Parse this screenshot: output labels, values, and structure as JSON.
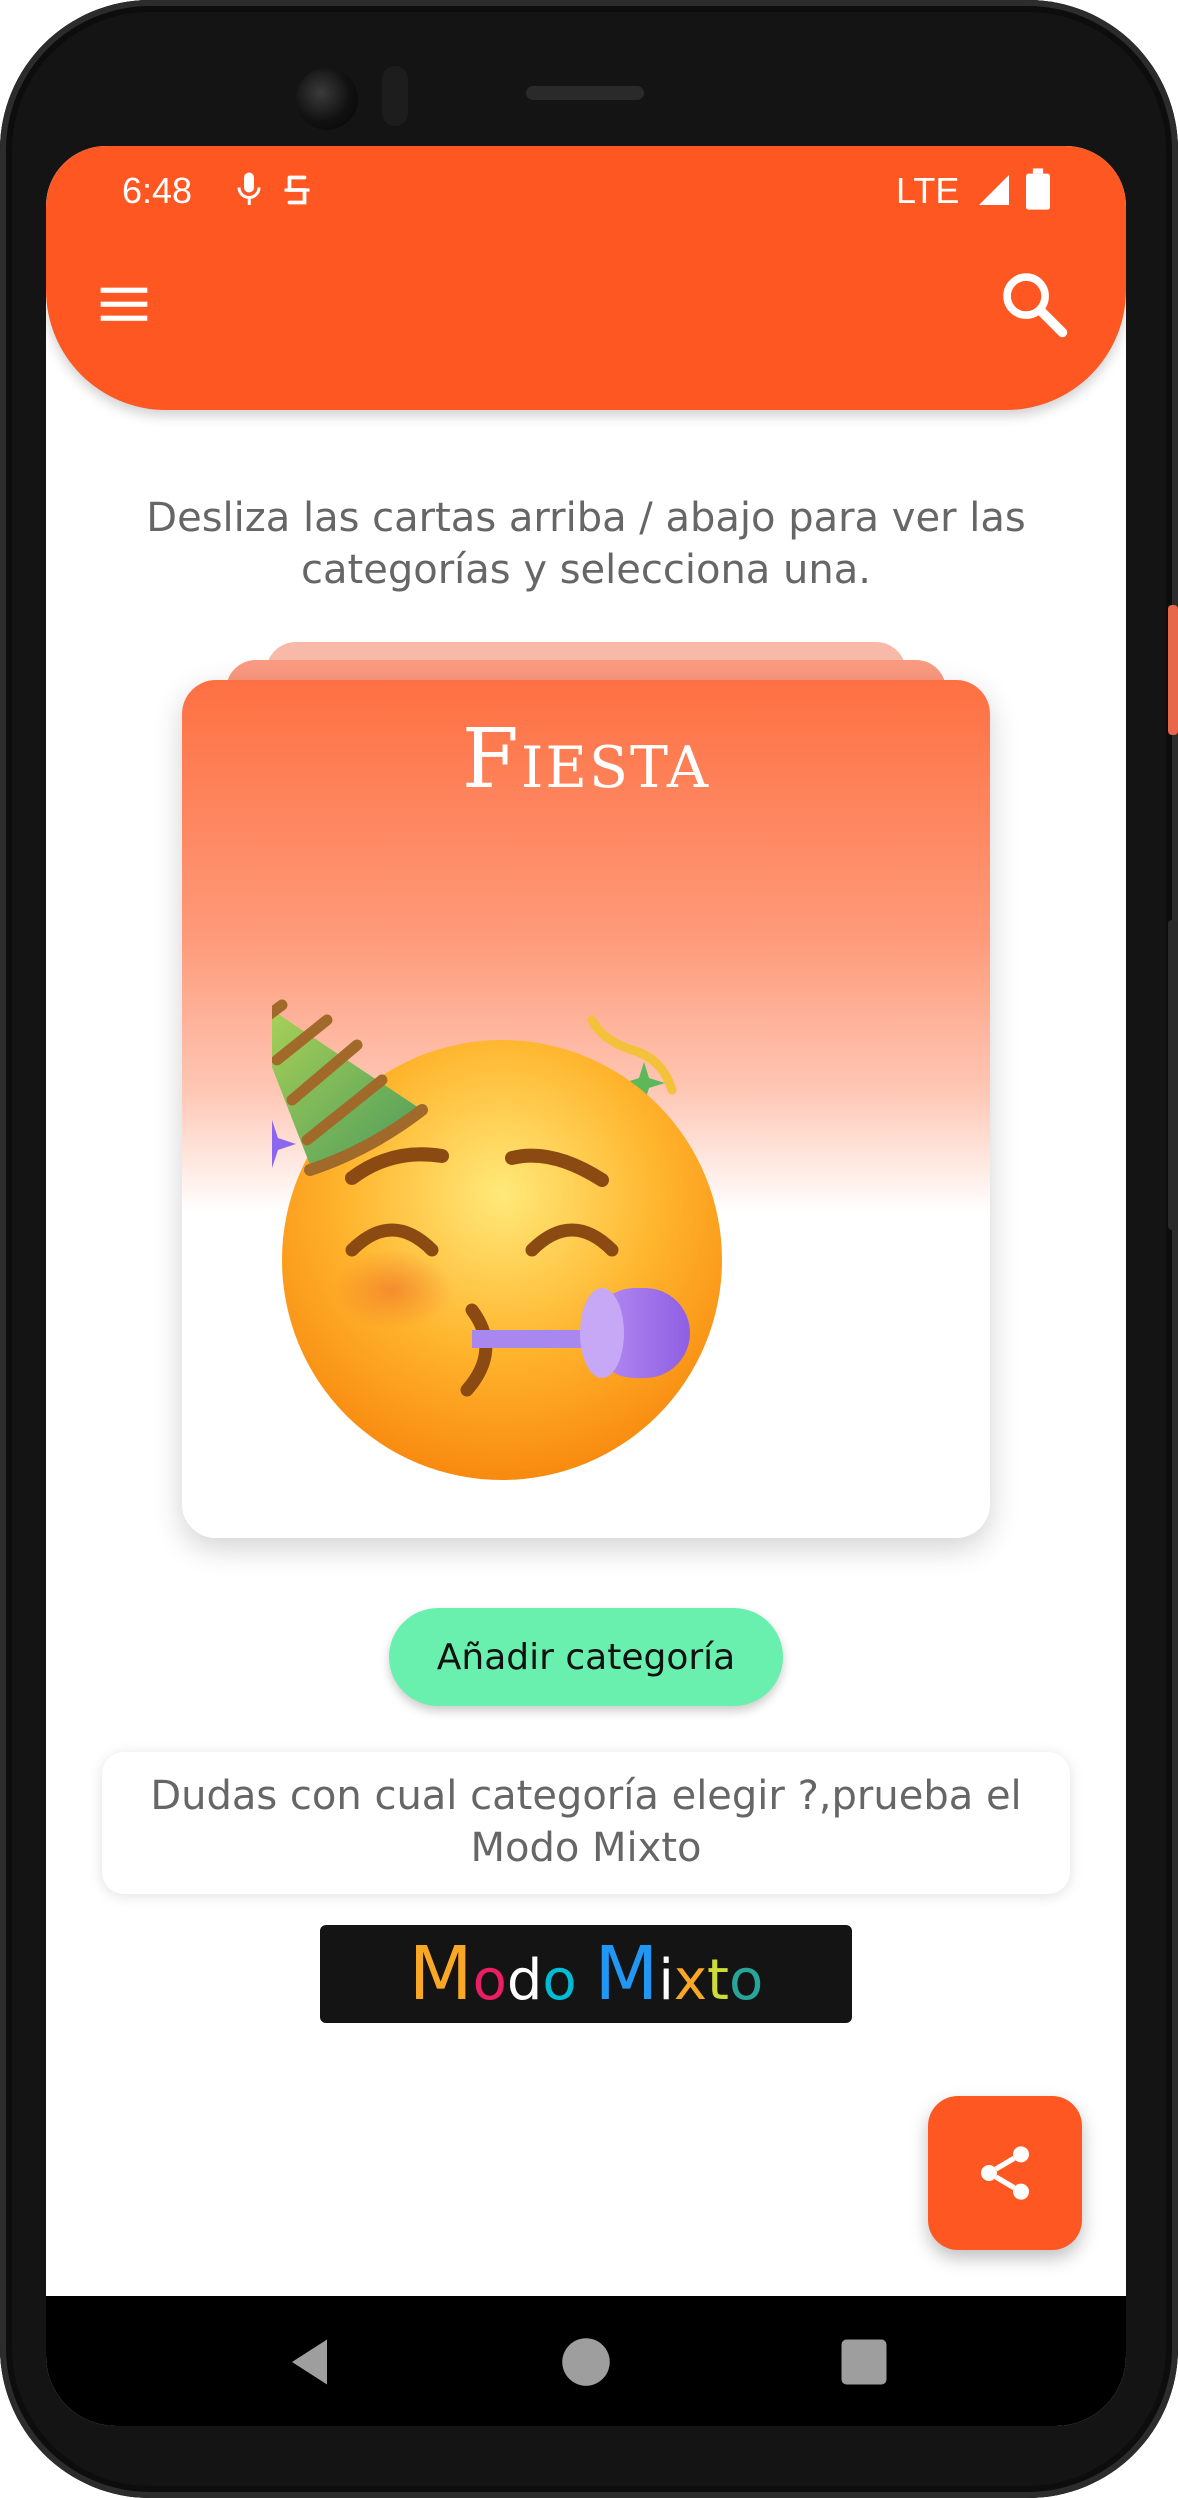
{
  "status_bar": {
    "time": "6:48",
    "network": "LTE"
  },
  "app_bar": {
    "color": "#fe5722",
    "menu_icon": "hamburger-menu-icon",
    "search_icon": "search-icon"
  },
  "instructions": "Desliza las cartas arriba / abajo para ver las categorías y selecciona una.",
  "category_card": {
    "title": "Fiesta",
    "image": "party-face-emoji"
  },
  "add_category_label": "Añadir categoría",
  "mixed_mode": {
    "prompt": "Dudas con cual categoría elegir ?,prueba el Modo Mixto",
    "banner_letters": [
      {
        "text": "M",
        "color": "#f9a825",
        "size": "big"
      },
      {
        "text": "o",
        "color": "#e91e63",
        "size": "small"
      },
      {
        "text": "d",
        "color": "#ffffff",
        "size": "small"
      },
      {
        "text": "o",
        "color": "#00bcd4",
        "size": "small"
      },
      {
        "text": " ",
        "color": "#ffffff",
        "size": "small"
      },
      {
        "text": "M",
        "color": "#2196f3",
        "size": "big"
      },
      {
        "text": "i",
        "color": "#ffffff",
        "size": "small"
      },
      {
        "text": "x",
        "color": "#f9a825",
        "size": "small"
      },
      {
        "text": "t",
        "color": "#cddc39",
        "size": "small"
      },
      {
        "text": "o",
        "color": "#26a69a",
        "size": "small"
      }
    ]
  },
  "share_icon": "share-icon",
  "nav": {
    "back_icon": "back-triangle-icon",
    "home_icon": "home-circle-icon",
    "recents_icon": "recents-square-icon"
  }
}
